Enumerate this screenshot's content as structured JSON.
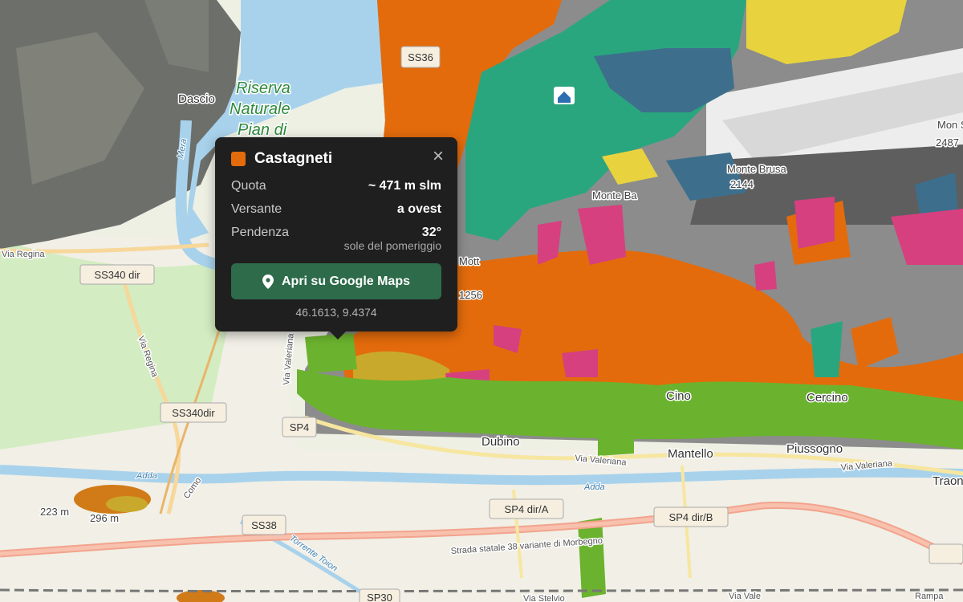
{
  "map": {
    "places": {
      "dascio": "Dascio",
      "dubino": "Dubino",
      "mantello": "Mantello",
      "piussogno": "Piussogno",
      "cino": "Cino",
      "cercino": "Cercino",
      "traona": "Traon",
      "monte_brusa": "Monte Brusa",
      "brusa_elev": "2144",
      "monte_bassetta": "Monte Ba",
      "monte_sciesa": "Mon Scie",
      "sciesa_elev": "2487",
      "monte_motta": "Mott",
      "monte_left_elev": "1256",
      "elev_223": "223 m",
      "elev_296": "296 m"
    },
    "reserve_lines": [
      "Riserva",
      "Naturale",
      "Pian di"
    ],
    "water": {
      "mera": "Mera",
      "adda_1": "Adda",
      "adda_2": "Adda",
      "torrente": "Torrente Toion"
    },
    "roads": {
      "ss36": "SS36",
      "ss340dir_1": "SS340 dir",
      "ss340dir_2": "SS340dir",
      "sp4": "SP4",
      "sp4dirA": "SP4 dir/A",
      "sp4dirB": "SP4 dir/B",
      "ss38": "SS38",
      "sp30": "SP30",
      "via_regina_1": "Via Regina",
      "via_regina_2": "Via Regina",
      "via_valeriana_1": "Via Valeriana",
      "via_valeriana_2": "Via Valeriana",
      "via_valeriana_3": "Via Valeriana",
      "strada_statale": "Strada statale 38 variante di Morbegno",
      "via_stelvio": "Via Stelvio",
      "rampa": "Rampa",
      "via_valeriana_bottom": "Via Vale",
      "como": "Como"
    }
  },
  "popup": {
    "title": "Castagneti",
    "swatch_color": "#e36b0c",
    "rows": [
      {
        "label": "Quota",
        "value": "~ 471 m slm"
      },
      {
        "label": "Versante",
        "value": "a ovest"
      },
      {
        "label": "Pendenza",
        "value": "32°"
      }
    ],
    "slope_note": "sole del pomeriggio",
    "button_label": "Apri su Google Maps",
    "coords": "46.1613, 9.4374",
    "close_symbol": "×"
  },
  "colors": {
    "castagneti": "#e36b0c",
    "conifer": "#2aa67e",
    "larch": "#3d6f8c",
    "meadow": "#6bb32e",
    "pink": "#d6407f",
    "yellow": "#e8d33f",
    "rock": "#8a8a8a",
    "lake": "#a8d2ec"
  }
}
